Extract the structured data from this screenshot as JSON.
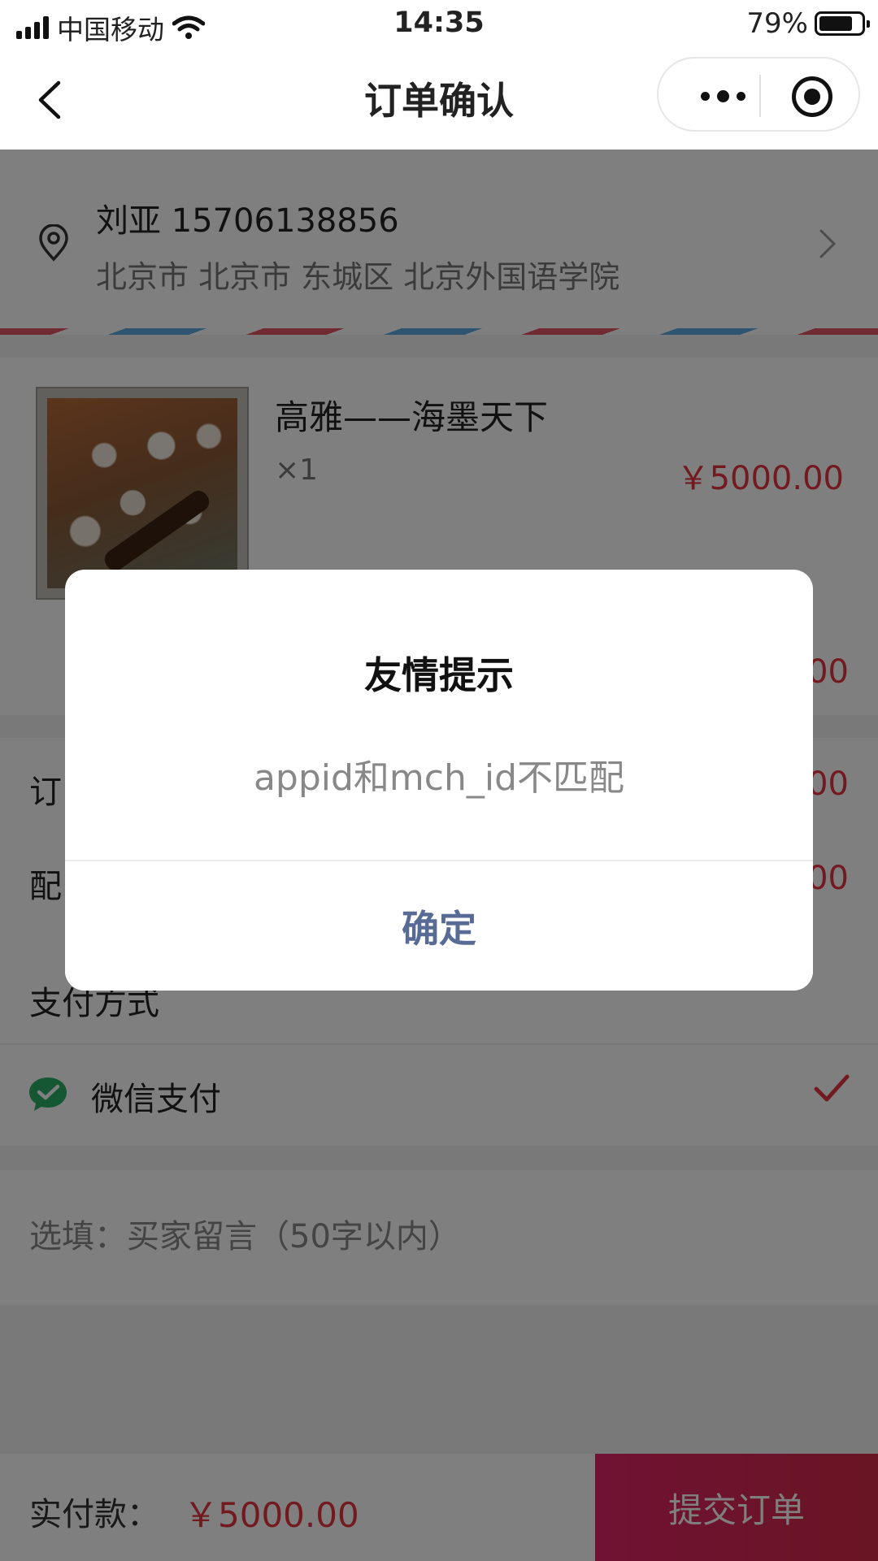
{
  "status_bar": {
    "carrier": "中国移动",
    "time": "14:35",
    "battery": "79%",
    "battery_level": 0.79
  },
  "nav": {
    "title": "订单确认"
  },
  "address": {
    "name_phone": "刘亚 15706138856",
    "line": "北京市 北京市 东城区 北京外国语学院"
  },
  "product": {
    "name": "高雅——海墨天下",
    "quantity": "×1",
    "price": "￥5000.00",
    "subtotal": "00"
  },
  "summary": {
    "rows": [
      {
        "label": "订",
        "value": "00"
      },
      {
        "label": "配",
        "value": "00"
      }
    ]
  },
  "payment": {
    "title": "支付方式",
    "method": "微信支付"
  },
  "message": {
    "placeholder": "选填：买家留言（50字以内）"
  },
  "bottom": {
    "pay_label": "实付款：",
    "pay_amount": "￥5000.00",
    "submit_label": "提交订单"
  },
  "dialog": {
    "title": "友情提示",
    "message": "appid和mch_id不匹配",
    "confirm_label": "确定"
  },
  "colors": {
    "accent_red": "#e5353f",
    "dialog_button": "#576b95",
    "submit_gradient_start": "#e12468",
    "submit_gradient_end": "#d32a47",
    "wechat_green": "#2aae67"
  }
}
